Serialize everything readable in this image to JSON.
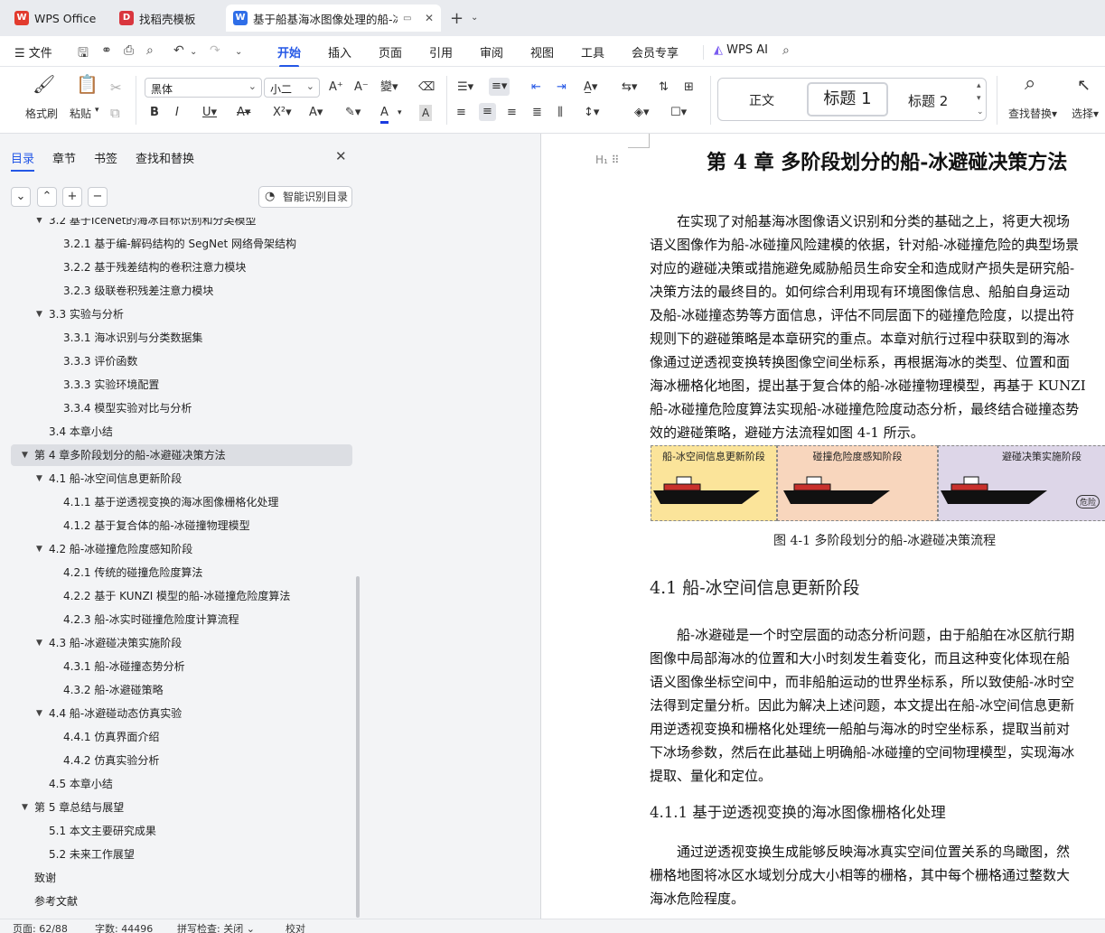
{
  "tabs": [
    {
      "label": "WPS Office",
      "icon": "wps-logo-icon"
    },
    {
      "label": "找稻壳模板",
      "icon": "docer-icon"
    },
    {
      "label": "基于船基海冰图像处理的船-冰",
      "icon": "writer-doc-icon"
    }
  ],
  "menu": {
    "file": "文件",
    "items": [
      "开始",
      "插入",
      "页面",
      "引用",
      "审阅",
      "视图",
      "工具",
      "会员专享"
    ],
    "active": "开始",
    "ai": "WPS AI"
  },
  "ribbon": {
    "format_painter": "格式刷",
    "paste": "粘贴",
    "font_name": "黑体",
    "font_size": "小二",
    "style_normal": "正文",
    "style_h1": "标题 1",
    "style_h2": "标题 2",
    "find_replace": "查找替换",
    "select": "选择"
  },
  "nav": {
    "tabs": [
      "目录",
      "章节",
      "书签",
      "查找和替换"
    ],
    "smart_button": "智能识别目录",
    "toc": [
      {
        "text": "3.2 基于IceNet的海冰目标识别和分类模型",
        "level": 2,
        "arrow": true
      },
      {
        "text": "3.2.1 基于编-解码结构的 SegNet 网络骨架结构",
        "level": 3
      },
      {
        "text": "3.2.2 基于残差结构的卷积注意力模块",
        "level": 3
      },
      {
        "text": "3.2.3 级联卷积残差注意力模块",
        "level": 3
      },
      {
        "text": "3.3 实验与分析",
        "level": 2,
        "arrow": true
      },
      {
        "text": "3.3.1 海冰识别与分类数据集",
        "level": 3
      },
      {
        "text": "3.3.3 评价函数",
        "level": 3
      },
      {
        "text": "3.3.3 实验环境配置",
        "level": 3
      },
      {
        "text": "3.3.4 模型实验对比与分析",
        "level": 3
      },
      {
        "text": "3.4 本章小结",
        "level": 2
      },
      {
        "text": "第 4 章多阶段划分的船-冰避碰决策方法",
        "level": 1,
        "arrow": true,
        "selected": true
      },
      {
        "text": "4.1 船-冰空间信息更新阶段",
        "level": 2,
        "arrow": true
      },
      {
        "text": "4.1.1 基于逆透视变换的海冰图像栅格化处理",
        "level": 3
      },
      {
        "text": "4.1.2 基于复合体的船-冰碰撞物理模型",
        "level": 3
      },
      {
        "text": "4.2 船-冰碰撞危险度感知阶段",
        "level": 2,
        "arrow": true
      },
      {
        "text": "4.2.1 传统的碰撞危险度算法",
        "level": 3
      },
      {
        "text": "4.2.2 基于 KUNZI 模型的船-冰碰撞危险度算法",
        "level": 3
      },
      {
        "text": "4.2.3 船-冰实时碰撞危险度计算流程",
        "level": 3
      },
      {
        "text": "4.3 船-冰避碰决策实施阶段",
        "level": 2,
        "arrow": true
      },
      {
        "text": "4.3.1 船-冰碰撞态势分析",
        "level": 3
      },
      {
        "text": "4.3.2 船-冰避碰策略",
        "level": 3
      },
      {
        "text": "4.4 船-冰避碰动态仿真实验",
        "level": 2,
        "arrow": true
      },
      {
        "text": "4.4.1 仿真界面介绍",
        "level": 3
      },
      {
        "text": "4.4.2 仿真实验分析",
        "level": 3
      },
      {
        "text": "4.5 本章小结",
        "level": 2
      },
      {
        "text": "第 5 章总结与展望",
        "level": 1,
        "arrow": true
      },
      {
        "text": "5.1 本文主要研究成果",
        "level": 2
      },
      {
        "text": "5.2 未来工作展望",
        "level": 2
      },
      {
        "text": "致谢",
        "level": 1
      },
      {
        "text": "参考文献",
        "level": 1
      }
    ]
  },
  "doc": {
    "chapter_title": "第 4 章  多阶段划分的船-冰避碰决策方法",
    "para1": [
      "　　在实现了对船基海冰图像语义识别和分类的基础之上，将更大视场",
      "语义图像作为船-冰碰撞风险建模的依据，针对船-冰碰撞危险的典型场景",
      "对应的避碰决策或措施避免威胁船员生命安全和造成财产损失是研究船-",
      "决策方法的最终目的。如何综合利用现有环境图像信息、船舶自身运动",
      "及船-冰碰撞态势等方面信息，评估不同层面下的碰撞危险度，以提出符",
      "规则下的避碰策略是本章研究的重点。本章对航行过程中获取到的海冰",
      "像通过逆透视变换转换图像空间坐标系，再根据海冰的类型、位置和面",
      "海冰栅格化地图，提出基于复合体的船-冰碰撞物理模型，再基于 KUNZI",
      "船-冰碰撞危险度算法实现船-冰碰撞危险度动态分析，最终结合碰撞态势",
      "效的避碰策略，避碰方法流程如图 4-1 所示。"
    ],
    "figure": {
      "stages": [
        "船-冰空间信息更新阶段",
        "碰撞危险度感知阶段",
        "避碰决策实施阶段"
      ],
      "stage_colors": [
        "#fbe49a",
        "#f8d6bd",
        "#ddd6e8"
      ],
      "partial_label": "危险",
      "caption": "图 4-1  多阶段划分的船-冰避碰决策流程"
    },
    "section_title": "4.1  船-冰空间信息更新阶段",
    "para2": [
      "　　船-冰避碰是一个时空层面的动态分析问题，由于船舶在冰区航行期",
      "图像中局部海冰的位置和大小时刻发生着变化，而且这种变化体现在船",
      "语义图像坐标空间中，而非船舶运动的世界坐标系，所以致使船-冰时空",
      "法得到定量分析。因此为解决上述问题，本文提出在船-冰空间信息更新",
      "用逆透视变换和栅格化处理统一船舶与海冰的时空坐标系，提取当前对",
      "下冰场参数，然后在此基础上明确船-冰碰撞的空间物理模型，实现海冰",
      "提取、量化和定位。"
    ],
    "subsection_title": "4.1.1  基于逆透视变换的海冰图像栅格化处理",
    "para3": [
      "　　通过逆透视变换生成能够反映海冰真实空间位置关系的鸟瞰图，然",
      "栅格地图将冰区水域划分成大小相等的栅格，其中每个栅格通过整数大",
      "海冰危险程度。"
    ]
  },
  "status": {
    "page": "页面: 62/88",
    "words": "字数: 44496",
    "spell": "拼写检查: 关闭",
    "proof": "校对"
  }
}
